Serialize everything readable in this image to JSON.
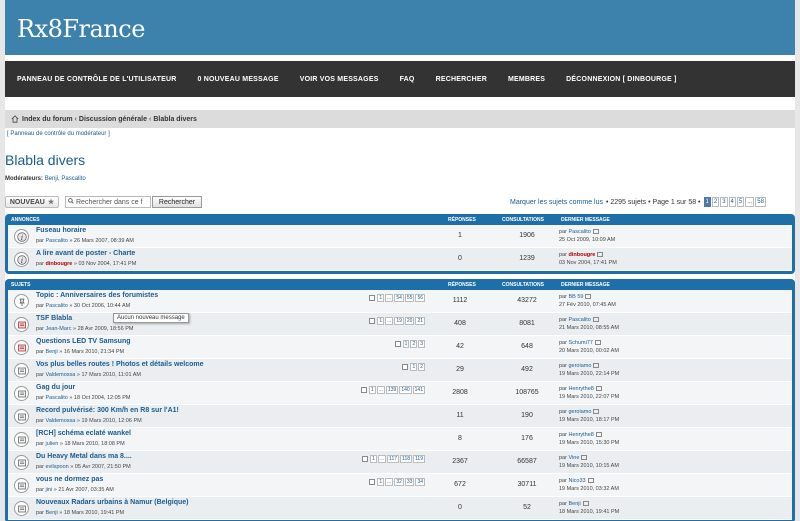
{
  "site": {
    "title": "Rx8France"
  },
  "nav": {
    "items": [
      "PANNEAU DE CONTRÔLE DE L'UTILISATEUR",
      "0 NOUVEAU MESSAGE",
      "VOIR VOS MESSAGES",
      "FAQ",
      "RECHERCHER",
      "MEMBRES",
      "DÉCONNEXION [ DINBOURGE ]"
    ]
  },
  "breadcrumb": {
    "items": [
      "Index du forum",
      "Discussion générale",
      "Blabla divers"
    ],
    "sep": "‹"
  },
  "modcp": {
    "label": "[ Panneau de contrôle du modérateur ]"
  },
  "forum": {
    "title": "Blabla divers",
    "moderators_label": "Modérateurs:",
    "moderators": [
      "Benji",
      "Pascalito"
    ]
  },
  "actions": {
    "new_label": "NOUVEAU",
    "search_placeholder": "Rechercher dans ce f",
    "search_button": "Rechercher"
  },
  "pagination": {
    "mark_read": "Marquer les sujets comme lus",
    "summary": "• 2295 sujets • Page 1 sur 58 •",
    "pages": [
      "1",
      "2",
      "3",
      "4",
      "5",
      "...",
      "58"
    ],
    "current": "1"
  },
  "announcements": {
    "header": {
      "title": "ANNONCES",
      "replies": "RÉPONSES",
      "views": "CONSULTATIONS",
      "last": "DERNIER MESSAGE"
    },
    "rows": [
      {
        "title": "Fuseau horaire",
        "by": "par",
        "author": "Pascalito",
        "author_red": false,
        "date": "» 26 Mars 2007, 08:39 AM",
        "replies": "1",
        "views": "1906",
        "last_by": "Pascalito",
        "last_red": false,
        "last_date": "25 Oct 2009, 10:09 AM"
      },
      {
        "title": "A lire avant de poster - Charte",
        "by": "par",
        "author": "dinbougre",
        "author_red": true,
        "date": "» 03 Nov 2004, 17:41 PM",
        "replies": "0",
        "views": "1239",
        "last_by": "dinbougre",
        "last_red": true,
        "last_date": "03 Nov 2004, 17:41 PM"
      }
    ]
  },
  "topics": {
    "header": {
      "title": "SUJETS",
      "replies": "RÉPONSES",
      "views": "CONSULTATIONS",
      "last": "DERNIER MESSAGE"
    },
    "rows": [
      {
        "title": "Topic : Anniversaires des forumistes",
        "prefix": "",
        "author": "Pascalito",
        "date": "» 30 Oct 2006, 10:44 AM",
        "pages": [
          "1",
          "...",
          "54",
          "55",
          "56"
        ],
        "replies": "1112",
        "views": "43272",
        "last_by": "BB 59",
        "last_date": "27 Fév 2010, 07:45 AM"
      },
      {
        "title": "TSF Blabla",
        "prefix": "",
        "author": "Jean-Marc",
        "date": "» 28 Avr 2009, 18:56 PM",
        "pages": [
          "1",
          "...",
          "19",
          "20",
          "21"
        ],
        "replies": "408",
        "views": "8081",
        "last_by": "Pascalito",
        "last_date": "21 Mars 2010, 08:55 AM"
      },
      {
        "title": "Questions LED TV Samsung",
        "prefix": "",
        "author": "Benji",
        "date": "» 16 Mars 2010, 21:34 PM",
        "pages": [
          "1",
          "2",
          "3"
        ],
        "replies": "42",
        "views": "648",
        "last_by": "Schumi77",
        "last_date": "20 Mars 2010, 00:02 AM"
      },
      {
        "title": "Vos plus belles routes ! Photos et détails welcome",
        "prefix": "",
        "author": "Valdemossa",
        "date": "» 17 Mars 2010, 11:01 AM",
        "pages": [
          "1",
          "2"
        ],
        "replies": "29",
        "views": "492",
        "last_by": "geroiamo",
        "last_date": "19 Mars 2010, 22:14 PM"
      },
      {
        "title": "Gag du jour",
        "prefix": "",
        "author": "Pascalito",
        "date": "» 18 Oct 2004, 12:05 PM",
        "pages": [
          "1",
          "...",
          "139",
          "140",
          "141"
        ],
        "replies": "2808",
        "views": "108765",
        "last_by": "Henrythe8",
        "last_date": "19 Mars 2010, 22:07 PM"
      },
      {
        "title": "Record pulvérisé: 300 Km/h en R8 sur l'A1!",
        "prefix": "",
        "author": "Valdemossa",
        "date": "» 19 Mars 2010, 12:06 PM",
        "pages": [],
        "replies": "11",
        "views": "190",
        "last_by": "geroiamo",
        "last_date": "19 Mars 2010, 18:17 PM"
      },
      {
        "title": "[RCH] schéma eclaté wankel",
        "prefix": "",
        "author": "julien",
        "date": "» 18 Mars 2010, 18:08 PM",
        "pages": [],
        "replies": "8",
        "views": "176",
        "last_by": "Henrythe8",
        "last_date": "19 Mars 2010, 15:30 PM"
      },
      {
        "title": "Du Heavy Metal dans ma 8....",
        "prefix": "",
        "author": "evilspoon",
        "date": "» 05 Avr 2007, 21:50 PM",
        "pages": [
          "1",
          "...",
          "117",
          "118",
          "119"
        ],
        "replies": "2367",
        "views": "66587",
        "last_by": "Vine",
        "last_date": "19 Mars 2010, 10:15 AM"
      },
      {
        "title": "vous ne dormez pas",
        "prefix": "",
        "author": "jini",
        "date": "» 21 Avr 2007, 03:35 AM",
        "pages": [
          "1",
          "...",
          "32",
          "33",
          "34"
        ],
        "replies": "672",
        "views": "30711",
        "last_by": "Nico33",
        "last_date": "19 Mars 2010, 03:32 AM"
      },
      {
        "title": "Nouveaux Radars urbains à Namur (Belgique)",
        "prefix": "",
        "author": "Benji",
        "date": "» 18 Mars 2010, 19:41 PM",
        "pages": [],
        "replies": "0",
        "views": "52",
        "last_by": "Benji",
        "last_date": "18 Mars 2010, 19:41 PM"
      }
    ]
  },
  "tooltip": {
    "text": "Aucun nouveau message"
  },
  "colors": {
    "header_bg": "#3c82ad",
    "nav_bg": "#333333",
    "table_header": "#1e6fa8",
    "link": "#1a5b8e"
  }
}
